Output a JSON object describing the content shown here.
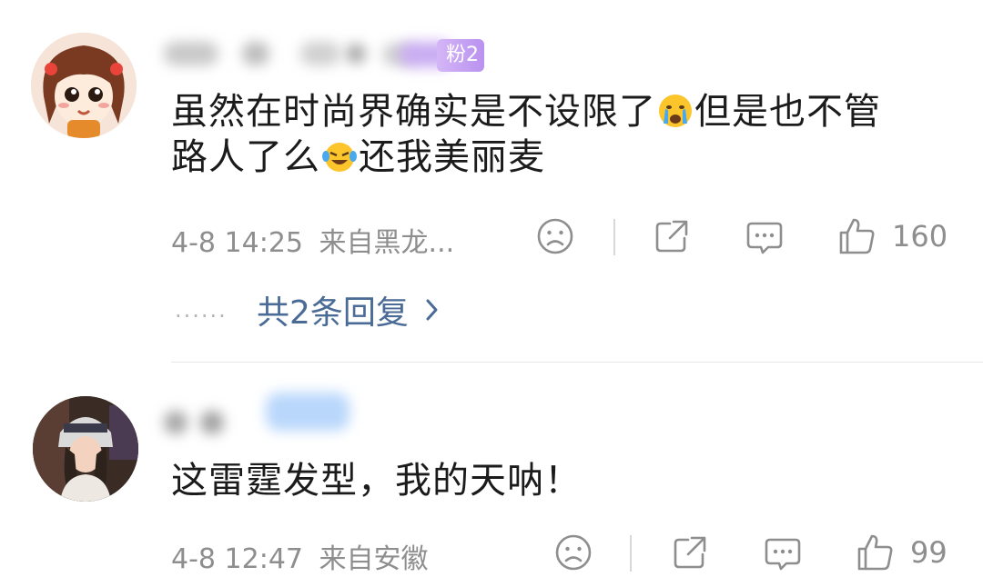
{
  "comments": [
    {
      "fan_badge": "粉2",
      "text_line1": "虽然在时尚界确实是不设限了",
      "text_mid": "但是也不管",
      "text_line2": "路人了么",
      "text_end": "还我美丽麦",
      "emoji_1": "crying-face-emoji",
      "emoji_2": "laughing-crying-face-emoji",
      "time": "4-8 14:25",
      "source": "来自黑龙...",
      "likes": "160",
      "replies_label": "共2条回复",
      "dots": "......"
    },
    {
      "text": "这雷霆发型，我的天呐！",
      "time": "4-8 12:47",
      "source": "来自安徽",
      "likes": "99"
    }
  ],
  "colors": {
    "link": "#4a6b95",
    "meta": "#8e8e8e",
    "badge": "#c6a4f3"
  },
  "icons": [
    "sad-face-icon",
    "share-icon",
    "comment-icon",
    "thumbs-up-icon",
    "chevron-right-icon"
  ]
}
